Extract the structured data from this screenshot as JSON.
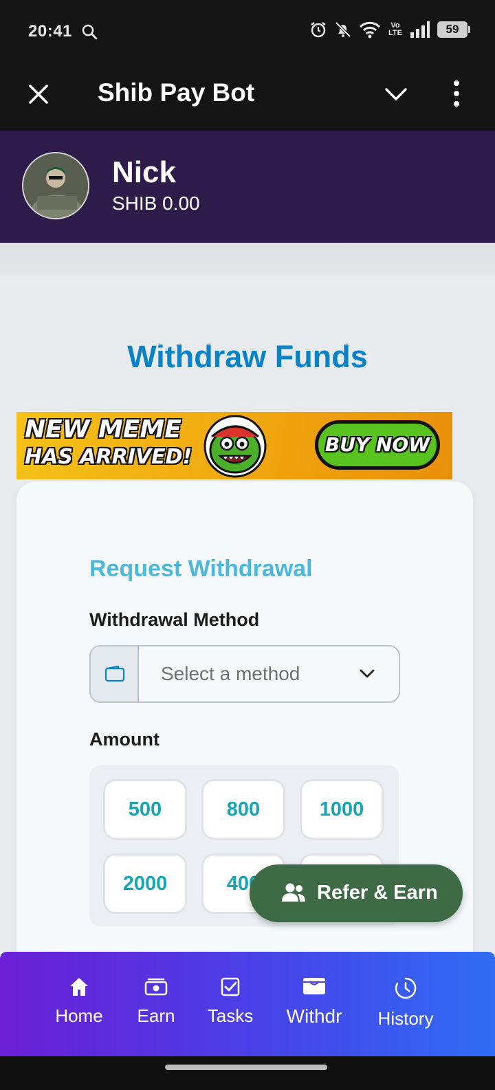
{
  "status_bar": {
    "time": "20:41",
    "battery": "59",
    "network_label": "Vo LTE",
    "icons": [
      "search-icon",
      "alarm-icon",
      "muted-bell-icon",
      "wifi-icon",
      "volte-icon",
      "signal-icon",
      "battery-icon"
    ]
  },
  "header": {
    "title": "Shib Pay Bot",
    "close_icon": "close-icon",
    "collapse_icon": "chevron-down-icon",
    "more_icon": "more-vertical-icon"
  },
  "user": {
    "name": "Nick",
    "balance": "SHIB 0.00"
  },
  "page": {
    "title": "Withdraw Funds"
  },
  "banner": {
    "line1": "NEW MEME",
    "line2": "HAS ARRIVED!",
    "cta": "BUY NOW"
  },
  "form": {
    "title": "Request Withdrawal",
    "method_label": "Withdrawal Method",
    "method_placeholder": "Select a method",
    "amount_label": "Amount",
    "amounts": [
      "500",
      "800",
      "1000",
      "2000",
      "400"
    ]
  },
  "fab": {
    "label": "Refer & Earn",
    "icon": "users-icon"
  },
  "nav": {
    "items": [
      {
        "label": "Home",
        "icon": "home-icon"
      },
      {
        "label": "Earn",
        "icon": "money-icon"
      },
      {
        "label": "Tasks",
        "icon": "checkbox-icon"
      },
      {
        "label": "Withdr",
        "icon": "wallet-icon"
      },
      {
        "label": "History",
        "icon": "clock-icon"
      }
    ]
  },
  "colors": {
    "header_bg": "#141414",
    "user_bar_bg": "#2d1b49",
    "title_blue": "#0a82c8",
    "card_title": "#4cb8de",
    "amount_teal": "#16a5b5",
    "fab_green": "#3e6b45",
    "nav_start": "#6b1fd6",
    "nav_end": "#2f6cf5"
  }
}
